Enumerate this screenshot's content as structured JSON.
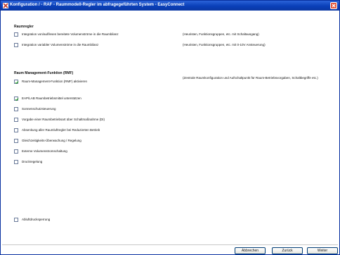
{
  "window": {
    "title": "Konfiguration / - RAF - Raummodell-Regler im abfragegeführten System - EasyConnect"
  },
  "raumregler": {
    "title": "Raumregler",
    "items": [
      {
        "label": "Integration von/auf/lesen bereitete Volumenströme in die Raumbilanz",
        "desc": "(Heuristen, Funktionsgruppen, etc. mit Schaltausgang)",
        "checked": false
      },
      {
        "label": "Integration variabler Volumenströme in die Raumbilanz",
        "desc": "(Heuristen, Funktionsgruppen, etc. mit 0-10V Ansteuerung)",
        "checked": false
      }
    ]
  },
  "rmf": {
    "title": "Raum Management-Funktion (RMF)",
    "items": [
      {
        "label": "Raum-Management-Funktion (RMF) aktivieren",
        "desc": "(Zentrale Raumkonfiguration und Aufschaltpunkt für Raum-Betriebsvorgaben, Schaltbegriffe etc.)",
        "checked": true
      },
      {
        "label": "EAP/LAB Raumbetriebsmittel unterstützen",
        "checked": true
      },
      {
        "label": "Sonnenschutzsteuerung",
        "checked": false
      },
      {
        "label": "Vorgabe einer Raumbetriebsart über Schaltmaßnahme (DI)",
        "checked": false
      },
      {
        "label": "Absenkung aller Raumluftregler bei Reduzierten Betrieb",
        "checked": false
      },
      {
        "label": "Gleichzeitigkeits-Überwachung / Regelung",
        "checked": false
      },
      {
        "label": "Externe Volumenstromschaltung",
        "checked": false
      },
      {
        "label": "Druckregelung",
        "checked": false
      },
      {
        "label": "Abluftdrucksperrung",
        "checked": false
      }
    ]
  },
  "buttons": {
    "cancel": "Abbrechen",
    "back": "Zurück",
    "next": "Weiter"
  }
}
